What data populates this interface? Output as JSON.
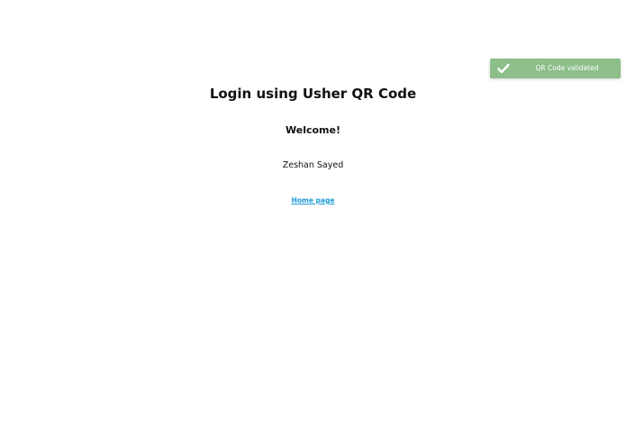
{
  "toast": {
    "message": "QR Code validated",
    "icon": "checkmark-icon",
    "background_color": "#8cbf8a"
  },
  "page": {
    "title": "Login using Usher QR Code",
    "welcome": "Welcome!",
    "user_name": "Zeshan Sayed",
    "home_link": "Home page",
    "link_color": "#1a9bd6"
  }
}
